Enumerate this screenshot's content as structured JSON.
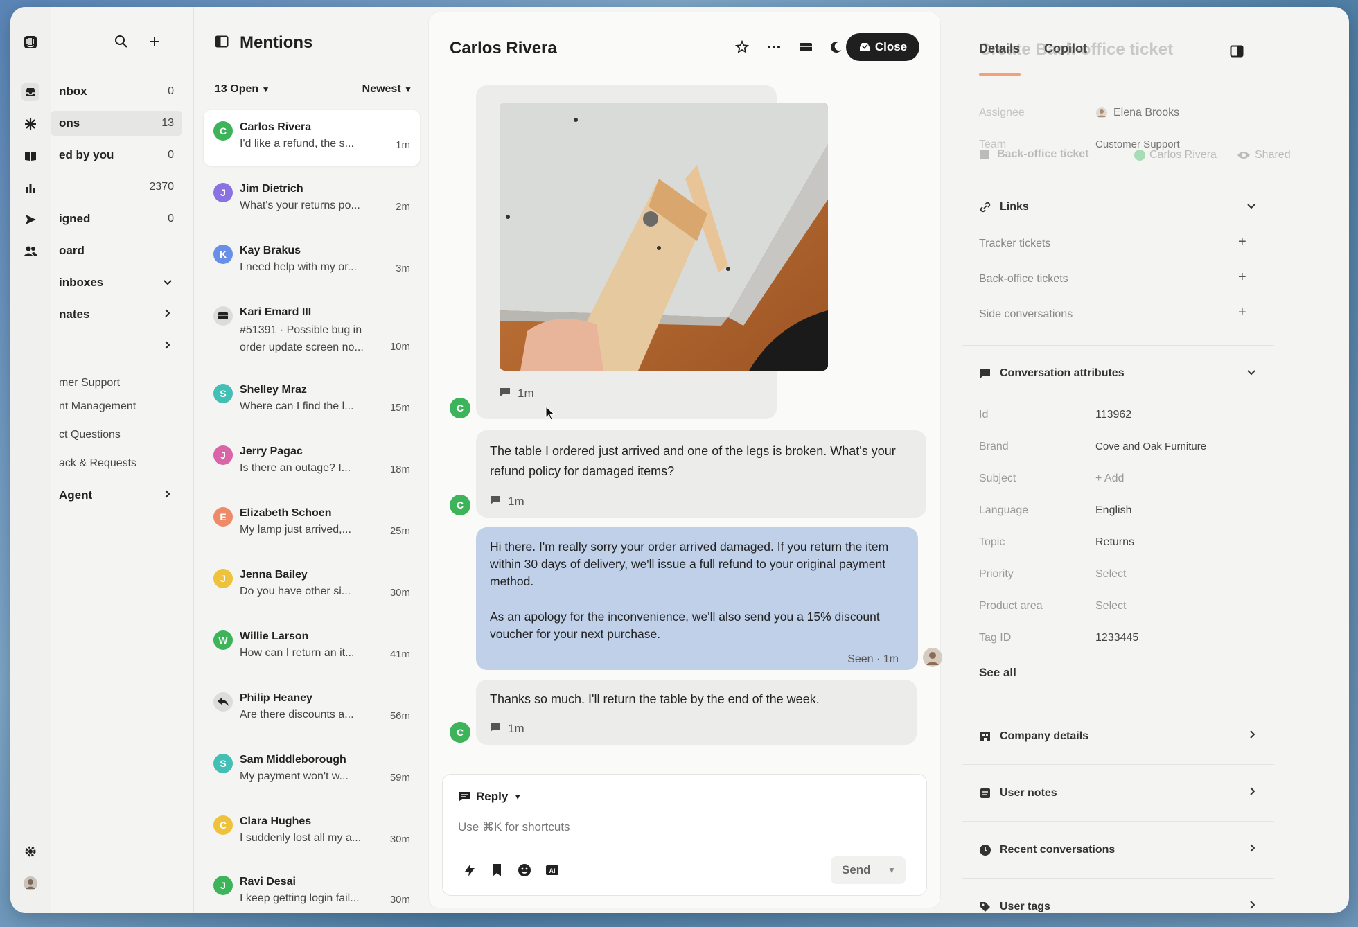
{
  "nav": {
    "items": [
      {
        "label": "nbox",
        "count": "0"
      },
      {
        "label": "ons",
        "count": "13"
      },
      {
        "label": "ed by you",
        "count": "0"
      },
      {
        "label": "",
        "count": "2370"
      },
      {
        "label": "igned",
        "count": "0"
      },
      {
        "label": "oard",
        "count": ""
      },
      {
        "label": "inboxes",
        "count": ""
      },
      {
        "label": "nates",
        "count": ""
      }
    ],
    "subs": [
      "mer Support",
      "nt Management",
      "ct Questions",
      "ack & Requests"
    ],
    "agent_label": "Agent"
  },
  "list": {
    "title": "Mentions",
    "open_filter": "13 Open",
    "sort_filter": "Newest",
    "conversations": [
      {
        "initial": "C",
        "name": "Carlos Rivera",
        "preview": "I'd like a refund, the s...",
        "time": "1m",
        "color": "#3db35a"
      },
      {
        "initial": "J",
        "name": "Jim Dietrich",
        "preview": "What's your returns po...",
        "time": "2m",
        "color": "#8a72e0"
      },
      {
        "initial": "K",
        "name": "Kay Brakus",
        "preview": "I need help with my or...",
        "time": "3m",
        "color": "#6a8fe6"
      },
      {
        "initial": "",
        "name": "Kari Emard III",
        "preview": "#51391 · Possible bug in order update screen no...",
        "time": "10m",
        "color": "#dcdcda"
      },
      {
        "initial": "S",
        "name": "Shelley Mraz",
        "preview": "Where can I find the l...",
        "time": "15m",
        "color": "#44bfb5"
      },
      {
        "initial": "J",
        "name": "Jerry Pagac",
        "preview": "Is there an outage? I...",
        "time": "18m",
        "color": "#d964a6"
      },
      {
        "initial": "E",
        "name": "Elizabeth Schoen",
        "preview": "My lamp just arrived,...",
        "time": "25m",
        "color": "#ef8a68"
      },
      {
        "initial": "J",
        "name": "Jenna Bailey",
        "preview": "Do you have other si...",
        "time": "30m",
        "color": "#eec23c"
      },
      {
        "initial": "W",
        "name": "Willie Larson",
        "preview": "How can I return an it...",
        "time": "41m",
        "color": "#3db35a"
      },
      {
        "initial": "",
        "name": "Philip Heaney",
        "preview": "Are there discounts a...",
        "time": "56m",
        "color": "#dcdcda"
      },
      {
        "initial": "S",
        "name": "Sam Middleborough",
        "preview": "My payment won't w...",
        "time": "59m",
        "color": "#44bfb5"
      },
      {
        "initial": "C",
        "name": "Clara Hughes",
        "preview": "I suddenly lost all my a...",
        "time": "30m",
        "color": "#eec23c"
      },
      {
        "initial": "J",
        "name": "Ravi Desai",
        "preview": "I keep getting login fail...",
        "time": "30m",
        "color": "#3db35a"
      }
    ]
  },
  "main": {
    "title": "Carlos Rivera",
    "close_label": "Close",
    "messages": [
      {
        "text": "",
        "time": "1m"
      },
      {
        "text": "The table I ordered just arrived and one of the legs is broken. What's your refund policy for damaged items?",
        "time": "1m"
      },
      {
        "text_p1": "Hi there. I'm really sorry your order arrived damaged. If you return the item within 30 days of delivery, we'll issue a full refund to your original payment method.",
        "text_p2": "As an apology for the inconvenience, we'll also send you a 15% discount voucher for your next purchase.",
        "status": "Seen · 1m"
      },
      {
        "text": "Thanks so much. I'll return the table by the end of the week.",
        "time": "1m"
      }
    ],
    "avatar_initial": "C",
    "composer": {
      "mode": "Reply",
      "placeholder": "Use ⌘K for shortcuts",
      "send_label": "Send"
    }
  },
  "side": {
    "tab_details": "Details",
    "tab_copilot": "Copilot",
    "ghost_title": "Create Back-office ticket",
    "assignee_label": "Assignee",
    "assignee_value": "Elena Brooks",
    "team_label": "Team",
    "team_value": "Customer Support",
    "overlay": {
      "ticket": "Back-office ticket",
      "person": "Carlos Rivera",
      "shared": "Shared"
    },
    "links_title": "Links",
    "links": [
      "Tracker tickets",
      "Back-office tickets",
      "Side conversations"
    ],
    "attrs_title": "Conversation attributes",
    "attrs": [
      {
        "k": "Id",
        "v": "113962"
      },
      {
        "k": "Brand",
        "v": "Cove and Oak Furniture"
      },
      {
        "k": "Subject",
        "v": "+ Add"
      },
      {
        "k": "Language",
        "v": "English"
      },
      {
        "k": "Topic",
        "v": "Returns"
      },
      {
        "k": "Priority",
        "v": "Select"
      },
      {
        "k": "Product area",
        "v": "Select"
      },
      {
        "k": "Tag ID",
        "v": "1233445"
      }
    ],
    "see_all": "See all",
    "sections": [
      "Company details",
      "User notes",
      "Recent conversations",
      "User tags"
    ]
  }
}
